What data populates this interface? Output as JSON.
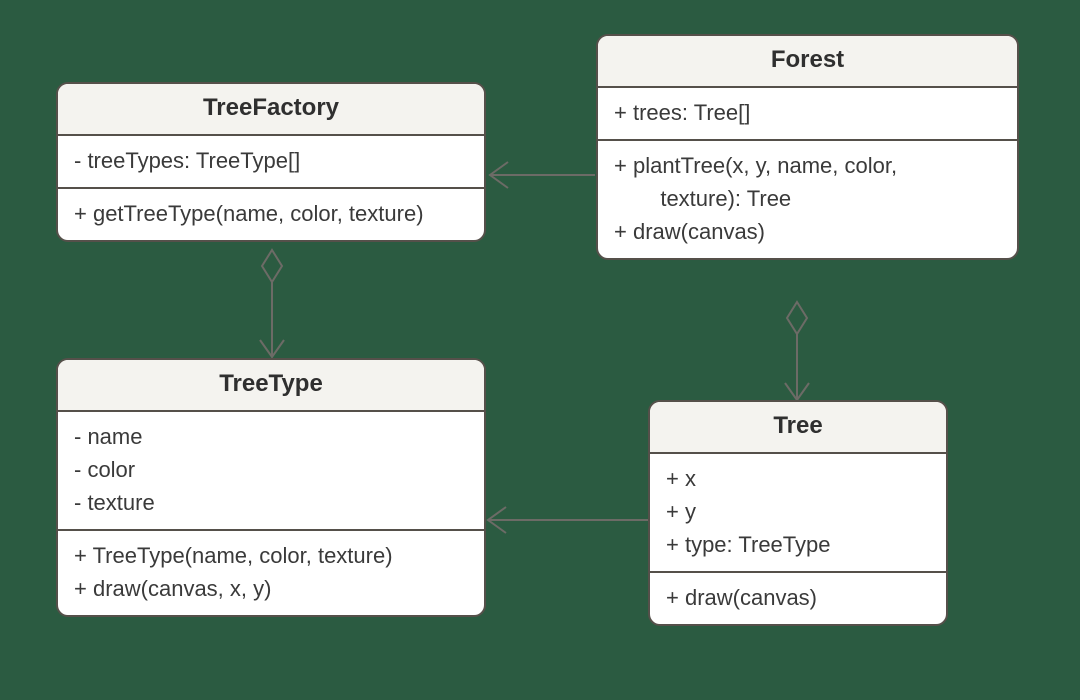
{
  "diagram": {
    "type": "uml-class",
    "classes": {
      "treeFactory": {
        "name": "TreeFactory",
        "attributes": [
          "- treeTypes: TreeType[]"
        ],
        "methods": [
          "+ getTreeType(name, color, texture)"
        ]
      },
      "forest": {
        "name": "Forest",
        "attributes": [
          "+ trees: Tree[]"
        ],
        "methods": [
          "+ plantTree(x, y, name, color,",
          "   texture): Tree",
          "+ draw(canvas)"
        ]
      },
      "treeType": {
        "name": "TreeType",
        "attributes": [
          "- name",
          "- color",
          "- texture"
        ],
        "methods": [
          "+ TreeType(name, color, texture)",
          "+ draw(canvas, x, y)"
        ]
      },
      "tree": {
        "name": "Tree",
        "attributes": [
          "+ x",
          "+ y",
          "+ type: TreeType"
        ],
        "methods": [
          "+ draw(canvas)"
        ]
      }
    },
    "relations": [
      {
        "from": "Forest",
        "to": "TreeFactory",
        "kind": "association-arrow"
      },
      {
        "from": "TreeFactory",
        "to": "TreeType",
        "kind": "aggregation"
      },
      {
        "from": "Forest",
        "to": "Tree",
        "kind": "aggregation"
      },
      {
        "from": "Tree",
        "to": "TreeType",
        "kind": "association-arrow"
      }
    ]
  }
}
